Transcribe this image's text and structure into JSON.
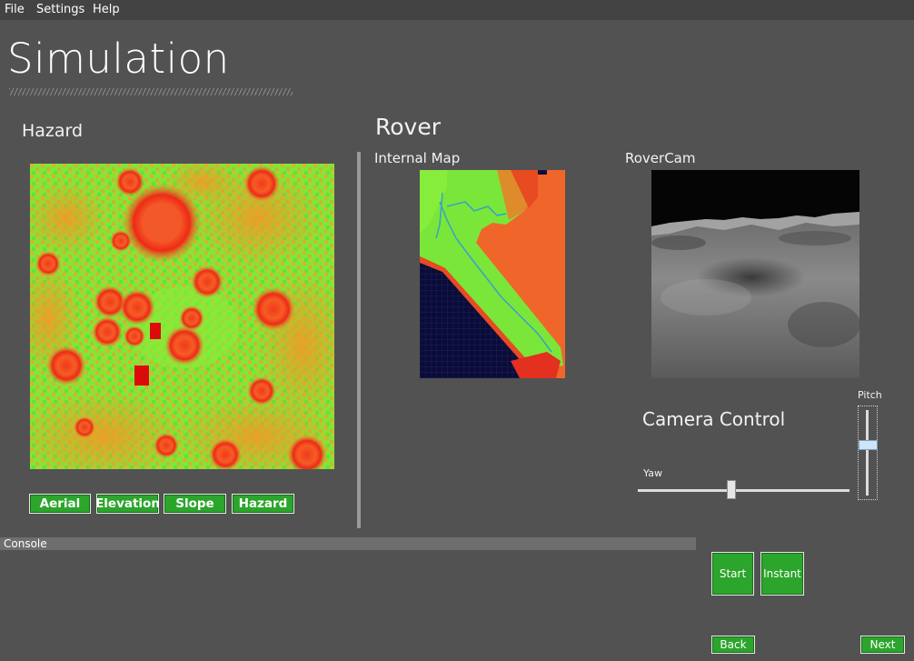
{
  "menu": {
    "file": "File",
    "settings": "Settings",
    "help": "Help"
  },
  "page_title": "Simulation",
  "hazard": {
    "heading": "Hazard",
    "buttons": {
      "aerial": "Aerial",
      "elevation": "Elevation",
      "slope": "Slope",
      "hazard": "Hazard"
    }
  },
  "rover": {
    "heading": "Rover",
    "internal_map_label": "Internal Map",
    "rovercam_label": "RoverCam"
  },
  "camera_control": {
    "heading": "Camera Control",
    "yaw_label": "Yaw",
    "pitch_label": "Pitch",
    "yaw_value": 0.44,
    "pitch_value": 0.6
  },
  "console": {
    "label": "Console"
  },
  "actions": {
    "start": "Start",
    "instant": "Instant",
    "back": "Back",
    "next": "Next"
  },
  "colors": {
    "accent_green": "#2ba52b",
    "background": "#525252",
    "menubar": "#434343"
  }
}
